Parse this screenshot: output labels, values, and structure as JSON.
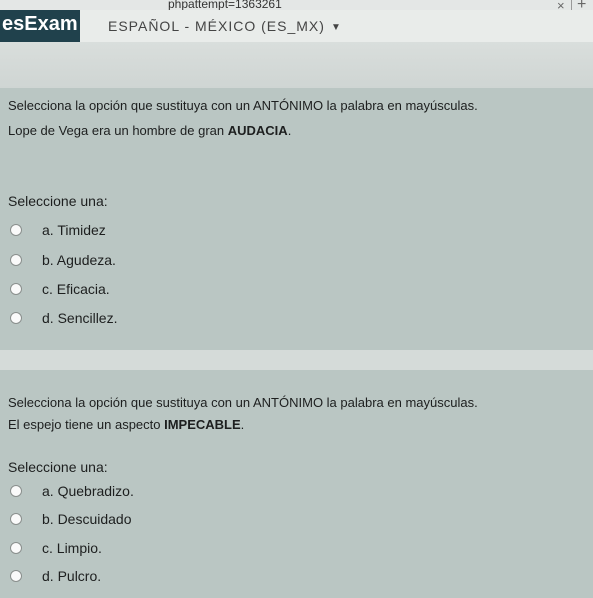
{
  "browser": {
    "url_text": "phpattempt=1363261",
    "close_symbol": "×",
    "new_tab_symbol": "+"
  },
  "header": {
    "logo_text": "esExam",
    "language_selector": "ESPAÑOL - MÉXICO (ES_MX)",
    "language_caret_icon": "caret-down-icon"
  },
  "questions": [
    {
      "instruction": "Selecciona la opción que sustituya con un ANTÓNIMO la palabra en mayúsculas.",
      "sentence_prefix": "Lope de Vega era un hombre de gran ",
      "sentence_bold": "AUDACIA",
      "sentence_suffix": ".",
      "prompt": "Seleccione una:",
      "options": [
        "a. Timidez",
        "b. Agudeza.",
        "c. Eficacia.",
        "d. Sencillez."
      ]
    },
    {
      "instruction": "Selecciona la opción que sustituya con un ANTÓNIMO la palabra en mayúsculas.",
      "sentence_prefix": "El espejo tiene un aspecto ",
      "sentence_bold": "IMPECABLE",
      "sentence_suffix": ".",
      "prompt": "Seleccione una:",
      "options": [
        "a. Quebradizo.",
        "b. Descuidado",
        "c. Limpio.",
        "d. Pulcro."
      ]
    }
  ]
}
